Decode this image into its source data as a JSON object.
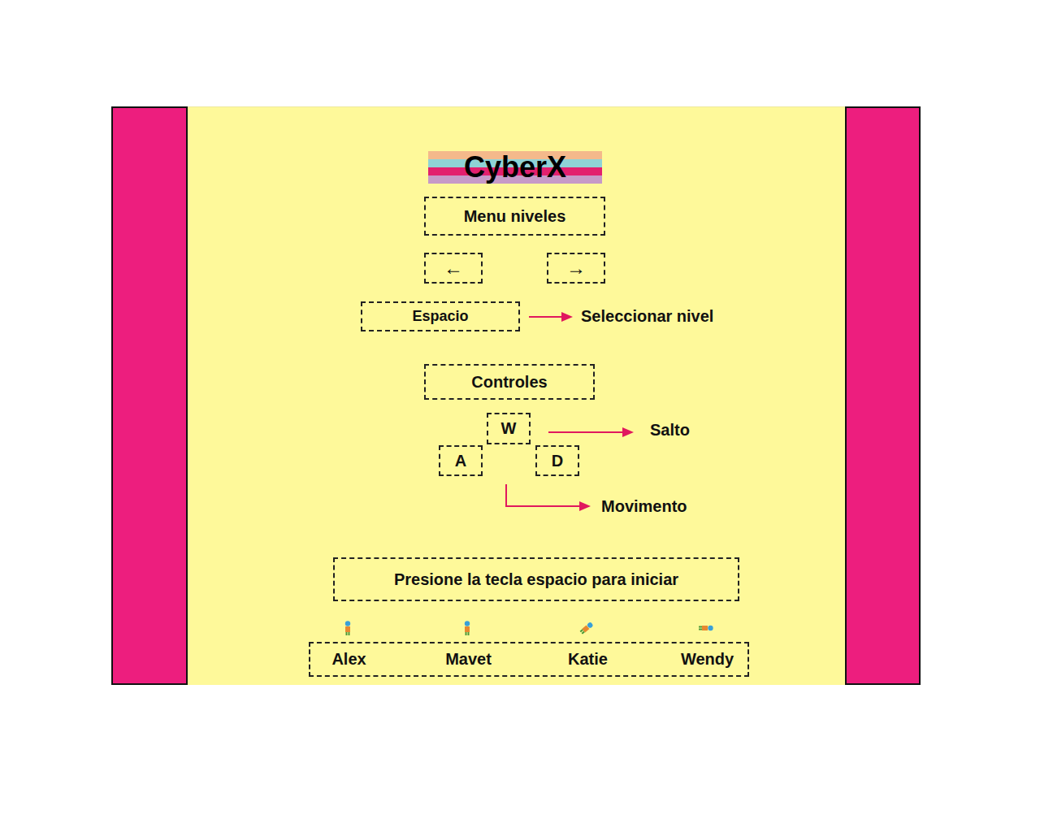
{
  "title": "CyberX",
  "level_menu": {
    "title": "Menu niveles",
    "prev": "←",
    "next": "→",
    "select_key": "Espacio",
    "select_action": "Seleccionar nivel"
  },
  "controls": {
    "title": "Controles",
    "jump_key": "W",
    "left_key": "A",
    "right_key": "D",
    "jump_action": "Salto",
    "move_action": "Movimento"
  },
  "start_prompt": "Presione la tecla espacio para iniciar",
  "characters": [
    {
      "name": "Alex",
      "kind": "standing"
    },
    {
      "name": "Mavet",
      "kind": "standing"
    },
    {
      "name": "Katie",
      "kind": "jumping"
    },
    {
      "name": "Wendy",
      "kind": "lying"
    }
  ]
}
